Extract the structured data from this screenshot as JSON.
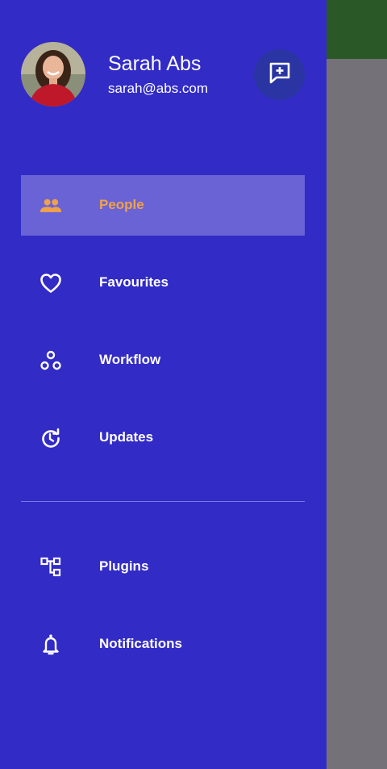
{
  "user": {
    "name": "Sarah Abs",
    "email": "sarah@abs.com"
  },
  "header": {
    "compose_icon": "add-comment-icon"
  },
  "menu": {
    "primary": [
      {
        "label": "People",
        "icon": "people-icon",
        "active": true
      },
      {
        "label": "Favourites",
        "icon": "heart-outline-icon",
        "active": false
      },
      {
        "label": "Workflow",
        "icon": "workflow-icon",
        "active": false
      },
      {
        "label": "Updates",
        "icon": "update-icon",
        "active": false
      }
    ],
    "secondary": [
      {
        "label": "Plugins",
        "icon": "plugins-icon",
        "active": false
      },
      {
        "label": "Notifications",
        "icon": "bell-icon",
        "active": false
      }
    ]
  },
  "colors": {
    "drawer_bg": "#322bc6",
    "active_item_bg": "#6a63d6",
    "active_accent": "#f0a24a",
    "compose_button_bg": "#2a35a3",
    "app_bar": "#2b5827",
    "scrim": "#747278"
  }
}
